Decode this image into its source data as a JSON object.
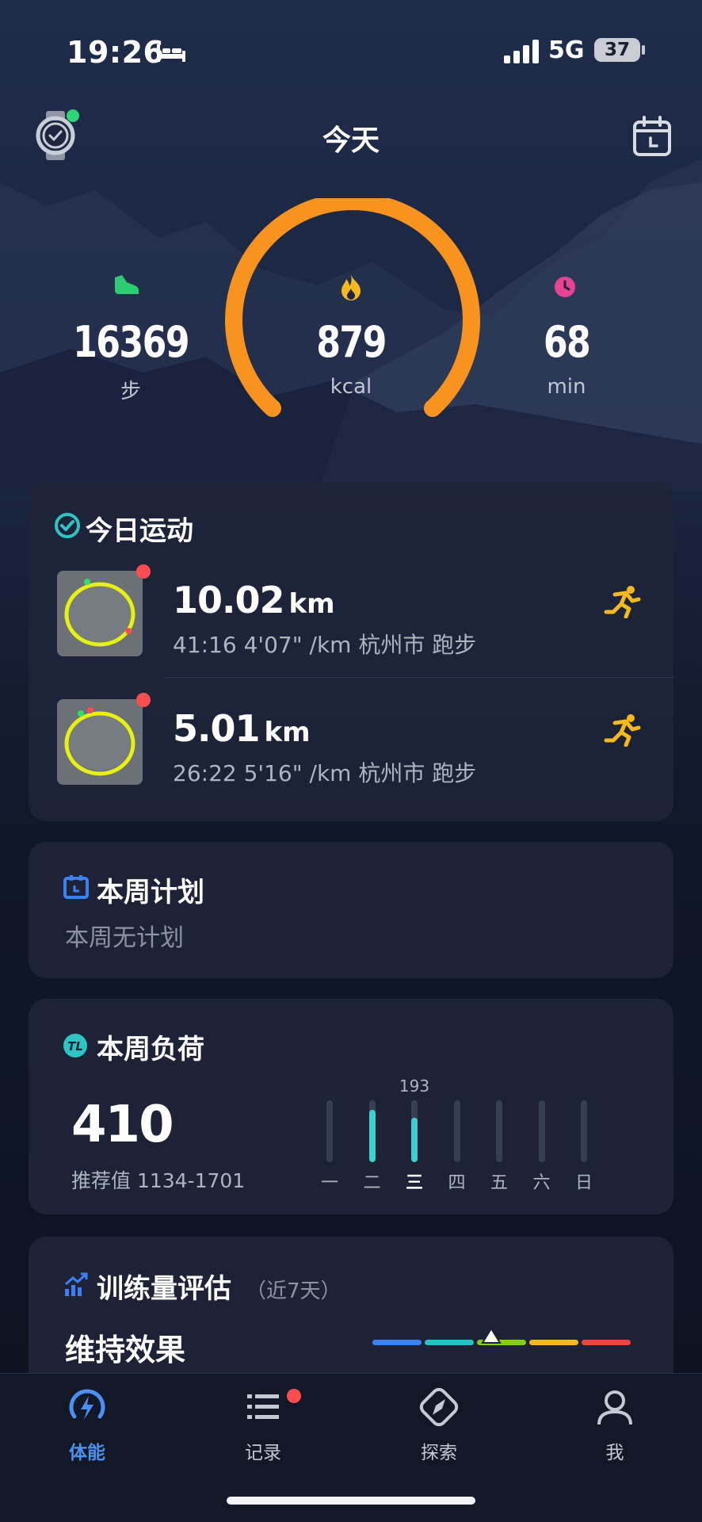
{
  "status_bar": {
    "time": "19:26",
    "network": "5G",
    "battery": "37"
  },
  "header": {
    "title": "今天"
  },
  "summary": {
    "steps": {
      "value": "16369",
      "unit": "步"
    },
    "calories": {
      "value": "879",
      "unit": "kcal"
    },
    "minutes": {
      "value": "68",
      "unit": "min"
    },
    "colors": {
      "arc": "#f7931e",
      "steps_icon": "#2ecc71",
      "fire_icon": "#f5b91e",
      "clock_icon": "#e84393"
    }
  },
  "today_exercise": {
    "title": "今日运动",
    "activities": [
      {
        "distance": "10.02",
        "unit": "km",
        "details": "41:16  4'07\" /km 杭州市 跑步",
        "icon": "running-icon"
      },
      {
        "distance": "5.01",
        "unit": "km",
        "details": "26:22  5'16\" /km 杭州市 跑步",
        "icon": "running-icon"
      }
    ]
  },
  "weekly_plan": {
    "title": "本周计划",
    "subtitle": "本周无计划"
  },
  "weekly_load": {
    "title": "本周负荷",
    "value": "410",
    "recommended": "推荐值 1134-1701",
    "peak_label": "193",
    "days": [
      "一",
      "二",
      "三",
      "四",
      "五",
      "六",
      "日"
    ],
    "current_day_index": 2,
    "levels": [
      0,
      0.85,
      0.72,
      0,
      0,
      0,
      0
    ]
  },
  "training_estimate": {
    "title": "训练量评估",
    "range": "（近7天）",
    "status": "维持效果",
    "scale_colors": [
      "#3b82f6",
      "#22c3c3",
      "#84cc16",
      "#f5b91e",
      "#ef4444"
    ],
    "marker_position": 0.46
  },
  "tabbar": {
    "tabs": [
      {
        "label": "体能",
        "icon": "fitness-icon",
        "active": true
      },
      {
        "label": "记录",
        "icon": "list-icon",
        "active": false
      },
      {
        "label": "探索",
        "icon": "compass-icon",
        "active": false
      },
      {
        "label": "我",
        "icon": "profile-icon",
        "active": false
      }
    ]
  }
}
